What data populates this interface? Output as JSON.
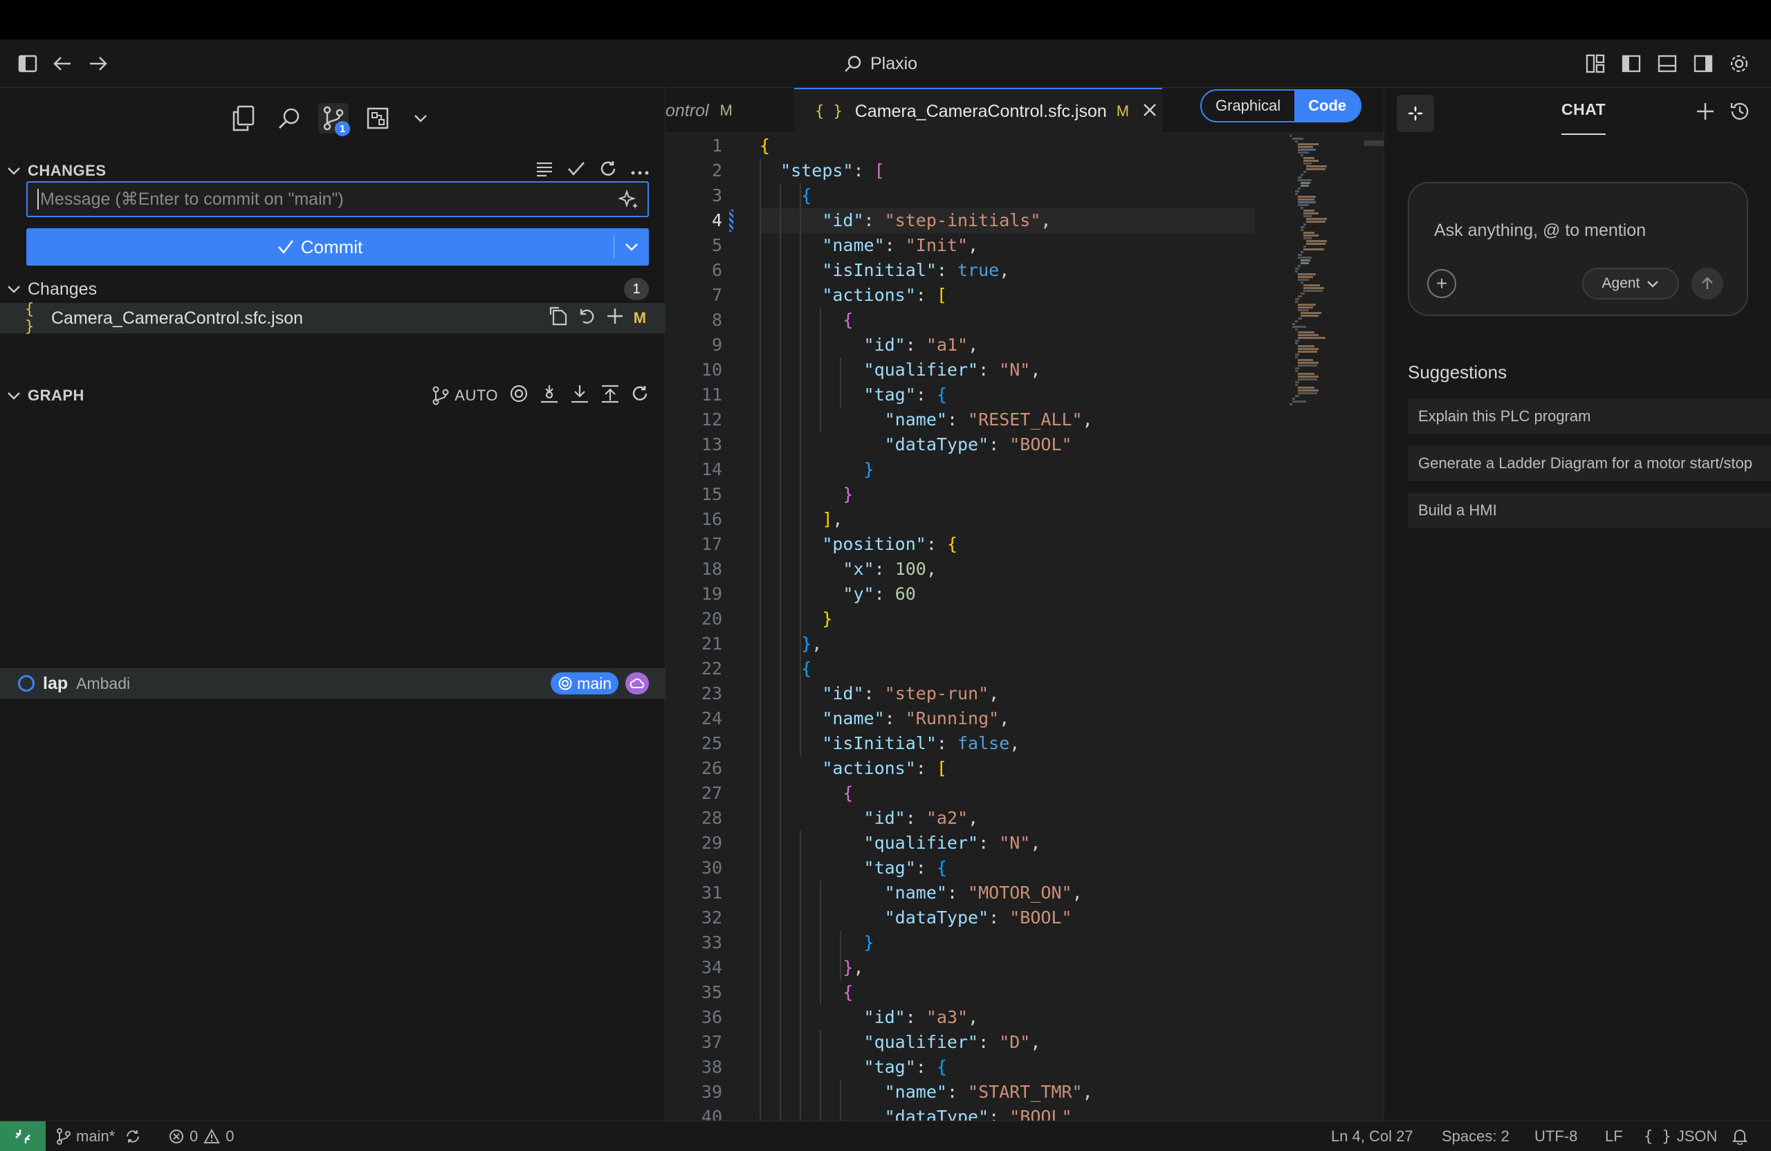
{
  "app": {
    "title": "Plaxio"
  },
  "scm": {
    "changes_header": "CHANGES",
    "message_placeholder": "Message (⌘Enter to commit on \"main\")",
    "commit_label": "Commit",
    "changes_group_label": "Changes",
    "changes_count": "1",
    "file": {
      "name": "Camera_CameraControl.sfc.json",
      "status": "M",
      "icon": "{ }"
    },
    "source_control_badge": "1"
  },
  "graph": {
    "header": "GRAPH",
    "auto_label": "AUTO",
    "commit": {
      "label": "lap",
      "author": "Ambadi",
      "branch": "main"
    }
  },
  "editor": {
    "tabs": [
      {
        "label": "ontrol",
        "status": "M"
      },
      {
        "label": "Camera_CameraControl.sfc.json",
        "status": "M",
        "icon": "{ }"
      }
    ],
    "view_options": [
      "Graphical",
      "Code"
    ],
    "active_view": "Code",
    "current_line": 4
  },
  "chat": {
    "title": "CHAT",
    "input_placeholder": "Ask anything, @ to mention",
    "agent_label": "Agent",
    "suggestions_title": "Suggestions",
    "suggestions": [
      "Explain this PLC program",
      "Generate a Ladder Diagram for a motor start/stop",
      "Build a HMI"
    ]
  },
  "status": {
    "branch": "main*",
    "errors": "0",
    "warnings": "0",
    "position": "Ln 4, Col 27",
    "spaces": "Spaces: 2",
    "encoding": "UTF-8",
    "eol": "LF",
    "language": "JSON",
    "language_icon": "{ }"
  },
  "colors": {
    "accent": "#3b82f6",
    "modified": "#e2c04a",
    "remote": "#2e8b57",
    "cloud": "#a66ad7"
  }
}
